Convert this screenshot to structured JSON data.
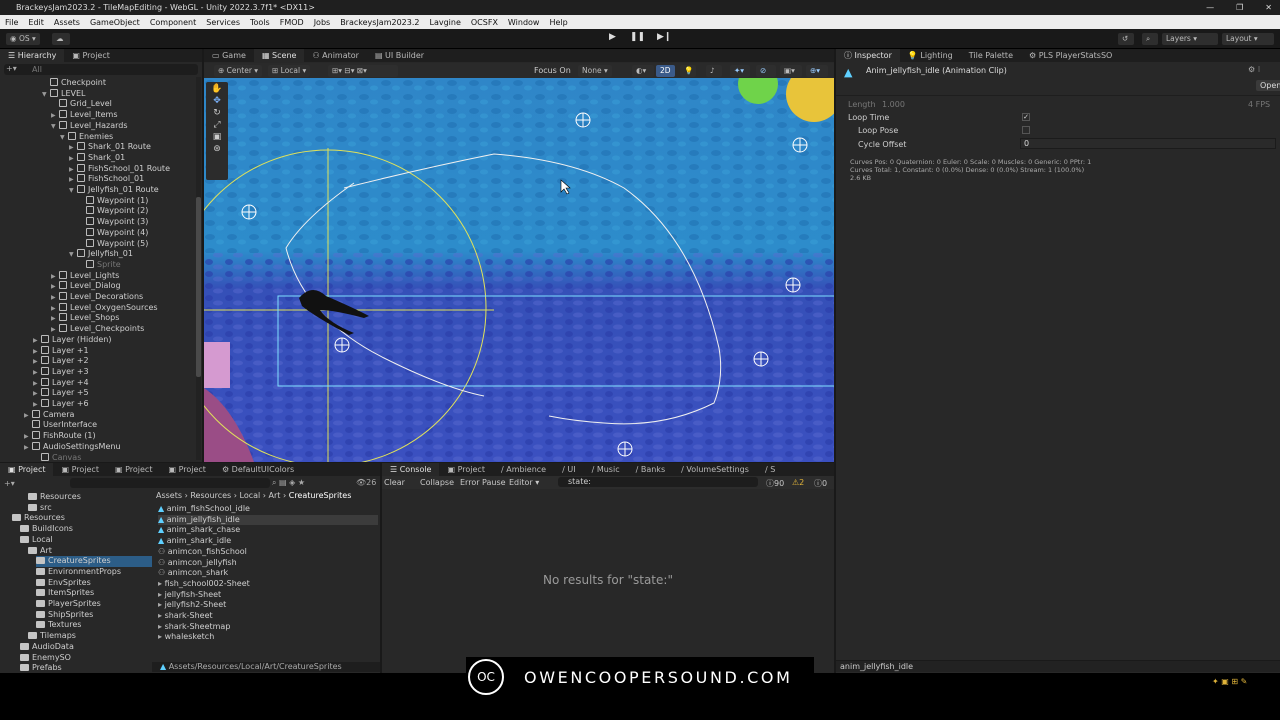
{
  "window": {
    "title": "BrackeysJam2023.2 - TileMapEditing - WebGL - Unity 2022.3.7f1* <DX11>",
    "controls": [
      "—",
      "❐",
      "✕"
    ]
  },
  "menu": [
    "File",
    "Edit",
    "Assets",
    "GameObject",
    "Component",
    "Services",
    "Tools",
    "FMOD",
    "Jobs",
    "BrackeysJam2023.2",
    "Lavgine",
    "OCSFX",
    "Window",
    "Help"
  ],
  "toolbar": {
    "account": "OS",
    "layers": "Layers",
    "layout": "Layout"
  },
  "hierarchy": {
    "tabs": [
      "Hierarchy",
      "Project"
    ],
    "search_placeholder": "All",
    "rows": [
      {
        "label": "Checkpoint",
        "indent": 4,
        "arrow": ""
      },
      {
        "label": "LEVEL",
        "indent": 4,
        "arrow": "▼"
      },
      {
        "label": "Grid_Level",
        "indent": 5,
        "arrow": ""
      },
      {
        "label": "Level_Items",
        "indent": 5,
        "arrow": "▶"
      },
      {
        "label": "Level_Hazards",
        "indent": 5,
        "arrow": "▼"
      },
      {
        "label": "Enemies",
        "indent": 6,
        "arrow": "▼"
      },
      {
        "label": "Shark_01 Route",
        "indent": 7,
        "arrow": "▶"
      },
      {
        "label": "Shark_01",
        "indent": 7,
        "arrow": "▶"
      },
      {
        "label": "FishSchool_01 Route",
        "indent": 7,
        "arrow": "▶"
      },
      {
        "label": "FishSchool_01",
        "indent": 7,
        "arrow": "▶"
      },
      {
        "label": "Jellyfish_01 Route",
        "indent": 7,
        "arrow": "▼"
      },
      {
        "label": "Waypoint (1)",
        "indent": 8,
        "arrow": ""
      },
      {
        "label": "Waypoint (2)",
        "indent": 8,
        "arrow": ""
      },
      {
        "label": "Waypoint (3)",
        "indent": 8,
        "arrow": ""
      },
      {
        "label": "Waypoint (4)",
        "indent": 8,
        "arrow": ""
      },
      {
        "label": "Waypoint (5)",
        "indent": 8,
        "arrow": ""
      },
      {
        "label": "Jellyfish_01",
        "indent": 7,
        "arrow": "▼"
      },
      {
        "label": "Sprite",
        "indent": 8,
        "arrow": "",
        "muted": true
      },
      {
        "label": "Level_Lights",
        "indent": 5,
        "arrow": "▶"
      },
      {
        "label": "Level_Dialog",
        "indent": 5,
        "arrow": "▶"
      },
      {
        "label": "Level_Decorations",
        "indent": 5,
        "arrow": "▶"
      },
      {
        "label": "Level_OxygenSources",
        "indent": 5,
        "arrow": "▶"
      },
      {
        "label": "Level_Shops",
        "indent": 5,
        "arrow": "▶"
      },
      {
        "label": "Level_Checkpoints",
        "indent": 5,
        "arrow": "▶"
      },
      {
        "label": "Layer (Hidden)",
        "indent": 3,
        "arrow": "▶"
      },
      {
        "label": "Layer +1",
        "indent": 3,
        "arrow": "▶"
      },
      {
        "label": "Layer +2",
        "indent": 3,
        "arrow": "▶"
      },
      {
        "label": "Layer +3",
        "indent": 3,
        "arrow": "▶"
      },
      {
        "label": "Layer +4",
        "indent": 3,
        "arrow": "▶"
      },
      {
        "label": "Layer +5",
        "indent": 3,
        "arrow": "▶"
      },
      {
        "label": "Layer +6",
        "indent": 3,
        "arrow": "▶"
      },
      {
        "label": "Camera",
        "indent": 2,
        "arrow": "▶"
      },
      {
        "label": "UserInterface",
        "indent": 2,
        "arrow": ""
      },
      {
        "label": "FishRoute (1)",
        "indent": 2,
        "arrow": "▶"
      },
      {
        "label": "AudioSettingsMenu",
        "indent": 2,
        "arrow": "▶"
      },
      {
        "label": "Canvas",
        "indent": 3,
        "arrow": "",
        "muted": true
      }
    ]
  },
  "scene_view": {
    "tabs": [
      "Game",
      "Scene",
      "Animator",
      "UI Builder"
    ],
    "pivot": "Center",
    "space": "Local",
    "focus_label": "Focus On",
    "focus_value": "None",
    "mode_2d": "2D"
  },
  "inspector": {
    "tabs": [
      "Inspector",
      "Lighting",
      "Tile Palette",
      "PLS PlayerStatsSO"
    ],
    "asset_title": "Anim_jellyfish_idle (Animation Clip)",
    "open_button": "Open",
    "length_label": "Length",
    "length_value": "1.000",
    "fps_value": "4 FPS",
    "loop_time_label": "Loop Time",
    "loop_time_checked": "✓",
    "loop_pose_label": "Loop Pose",
    "cycle_offset_label": "Cycle Offset",
    "cycle_offset_value": "0",
    "curves_line1": "Curves Pos: 0 Quaternion: 0 Euler: 0 Scale: 0 Muscles: 0 Generic: 0 PPtr: 1",
    "curves_line2": "Curves Total: 1, Constant: 0 (0.0%) Dense: 0 (0.0%) Stream: 1 (100.0%)",
    "curves_line3": "2.6 KB",
    "footer": "anim_jellyfish_idle"
  },
  "project": {
    "tabs": [
      "Project",
      "Project",
      "Project",
      "Project",
      "DefaultUIColors"
    ],
    "breadcrumb": [
      "Assets",
      "Resources",
      "Local",
      "Art",
      "CreatureSprites"
    ],
    "count": "26",
    "folders": [
      {
        "label": "Resources",
        "indent": 3
      },
      {
        "label": "src",
        "indent": 3
      },
      {
        "label": "Resources",
        "indent": 1
      },
      {
        "label": "BuildIcons",
        "indent": 2
      },
      {
        "label": "Local",
        "indent": 2
      },
      {
        "label": "Art",
        "indent": 3
      },
      {
        "label": "CreatureSprites",
        "indent": 4,
        "selected": true
      },
      {
        "label": "EnvironmentProps",
        "indent": 4
      },
      {
        "label": "EnvSprites",
        "indent": 4
      },
      {
        "label": "ItemSprites",
        "indent": 4
      },
      {
        "label": "PlayerSprites",
        "indent": 4
      },
      {
        "label": "ShipSprites",
        "indent": 4
      },
      {
        "label": "Textures",
        "indent": 4
      },
      {
        "label": "Tilemaps",
        "indent": 3
      },
      {
        "label": "AudioData",
        "indent": 2
      },
      {
        "label": "EnemySO",
        "indent": 2
      },
      {
        "label": "Prefabs",
        "indent": 2
      }
    ],
    "assets": [
      {
        "label": "anim_fishSchool_idle",
        "selected": false
      },
      {
        "label": "anim_jellyfish_idle",
        "selected": true
      },
      {
        "label": "anim_shark_chase",
        "selected": false
      },
      {
        "label": "anim_shark_idle",
        "selected": false
      },
      {
        "label": "animcon_fishSchool",
        "selected": false
      },
      {
        "label": "animcon_jellyfish",
        "selected": false
      },
      {
        "label": "animcon_shark",
        "selected": false
      },
      {
        "label": "fish_school002-Sheet",
        "selected": false
      },
      {
        "label": "jellyfish-Sheet",
        "selected": false
      },
      {
        "label": "jellyfish2-Sheet",
        "selected": false
      },
      {
        "label": "shark-Sheet",
        "selected": false
      },
      {
        "label": "shark-Sheetmap",
        "selected": false
      },
      {
        "label": "whalesketch",
        "selected": false
      }
    ],
    "path": "Assets/Resources/Local/Art/CreatureSprites"
  },
  "console": {
    "tabs": [
      "Console",
      "Project",
      "Ambience",
      "UI",
      "Music",
      "Banks",
      "VolumeSettings",
      "S"
    ],
    "clear": "Clear",
    "collapse": "Collapse",
    "error_pause": "Error Pause",
    "editor": "Editor",
    "search": "state:",
    "log_count": "90",
    "warn_count": "2",
    "error_count": "0",
    "empty": "No results for \"state:\""
  },
  "banner": {
    "logo": "OC",
    "text": "OWENCOOPERSOUND.COM"
  }
}
